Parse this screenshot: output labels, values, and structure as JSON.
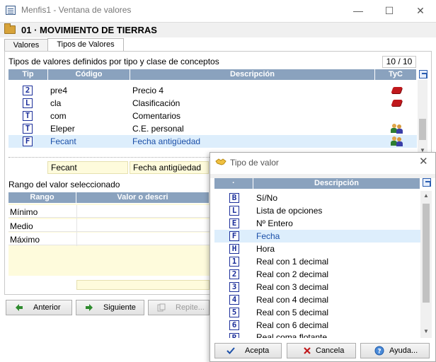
{
  "window": {
    "title": "Menfis1 - Ventana de valores",
    "minimize": "—",
    "maximize": "☐",
    "close": "✕"
  },
  "header": {
    "title": "01 · MOVIMIENTO DE TIERRAS"
  },
  "tabs": [
    {
      "label": "Valores"
    },
    {
      "label": "Tipos de Valores"
    }
  ],
  "types_section": {
    "caption": "Tipos de valores definidos por tipo y clase de conceptos",
    "counter": "10 / 10",
    "columns": {
      "tip": "Tip",
      "codigo": "Código",
      "descripcion": "Descripción",
      "tyc": "TyC"
    },
    "rows": [
      {
        "tip": "2",
        "codigo": "pre4",
        "descripcion": "Precio 4",
        "tyc": "red"
      },
      {
        "tip": "L",
        "codigo": "cla",
        "descripcion": "Clasificación",
        "tyc": "red"
      },
      {
        "tip": "T",
        "codigo": "com",
        "descripcion": "Comentarios",
        "tyc": ""
      },
      {
        "tip": "T",
        "codigo": "Eleper",
        "descripcion": "C.E. personal",
        "tyc": "users"
      },
      {
        "tip": "F",
        "codigo": "Fecant",
        "descripcion": "Fecha antigüedad",
        "tyc": "users",
        "selected": true
      }
    ],
    "edit": {
      "codigo": "Fecant",
      "descripcion": "Fecha antigüedad"
    }
  },
  "range_section": {
    "caption": "Rango del valor seleccionado",
    "columns": {
      "rango": "Rango",
      "valor": "Valor o descri"
    },
    "rows": [
      {
        "label": "Mínimo"
      },
      {
        "label": "Medio"
      },
      {
        "label": "Máximo"
      }
    ]
  },
  "buttons": {
    "anterior": "Anterior",
    "siguiente": "Siguiente",
    "repite": "Repite..."
  },
  "dialog": {
    "title": "Tipo de valor",
    "columns": {
      "dot": "·",
      "descripcion": "Descripción"
    },
    "rows": [
      {
        "tip": "B",
        "descripcion": "Sí/No"
      },
      {
        "tip": "L",
        "descripcion": "Lista de opciones"
      },
      {
        "tip": "E",
        "descripcion": "Nº Entero"
      },
      {
        "tip": "F",
        "descripcion": "Fecha",
        "selected": true
      },
      {
        "tip": "H",
        "descripcion": "Hora"
      },
      {
        "tip": "1",
        "descripcion": "Real con 1 decimal"
      },
      {
        "tip": "2",
        "descripcion": "Real con 2 decimal"
      },
      {
        "tip": "3",
        "descripcion": "Real con 3 decimal"
      },
      {
        "tip": "4",
        "descripcion": "Real con 4 decimal"
      },
      {
        "tip": "5",
        "descripcion": "Real con 5 decimal"
      },
      {
        "tip": "6",
        "descripcion": "Real con 6 decimal"
      },
      {
        "tip": "R",
        "descripcion": "Real coma flotante"
      }
    ],
    "buttons": {
      "acepta": "Acepta",
      "cancela": "Cancela",
      "ayuda": "Ayuda..."
    }
  }
}
